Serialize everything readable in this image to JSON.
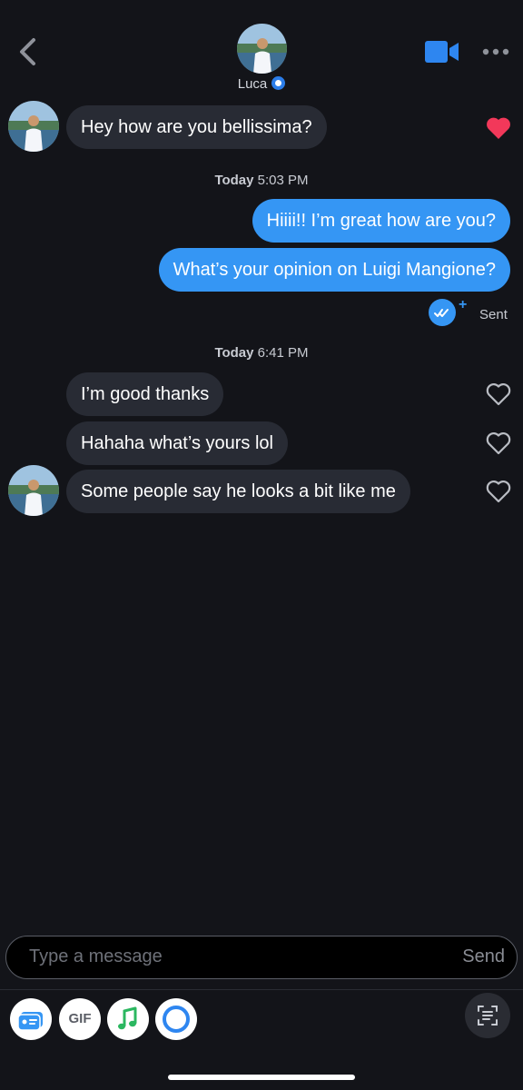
{
  "header": {
    "contact_name": "Luca",
    "back_icon": "chevron-left-icon",
    "video_icon": "video-camera-icon",
    "more_icon": "more-dots-icon",
    "verified_icon": "verified-badge-icon",
    "accent": "#2b7de9"
  },
  "messages": {
    "first_incoming": "Hey how are you bellissima?",
    "timestamp1": {
      "day": "Today",
      "time": "5:03 PM"
    },
    "outgoing1": "Hiiii!! I’m great how are you?",
    "outgoing2": "What’s your opinion on Luigi Mangione?",
    "sent_status": "Sent",
    "timestamp2": {
      "day": "Today",
      "time": "6:41 PM"
    },
    "incoming2": "I’m good thanks",
    "incoming3": "Hahaha what’s yours lol",
    "incoming4": "Some people say he looks a bit like me",
    "liked_color": "#f2385a",
    "outgoing_color": "#3596f4",
    "incoming_color": "#282b34"
  },
  "composer": {
    "placeholder": "Type a message",
    "send_label": "Send"
  },
  "toolbar": {
    "gif_label": "GIF",
    "icons": [
      "id-card-icon",
      "gif-icon",
      "music-note-icon",
      "circle-icon",
      "scan-text-icon"
    ]
  }
}
